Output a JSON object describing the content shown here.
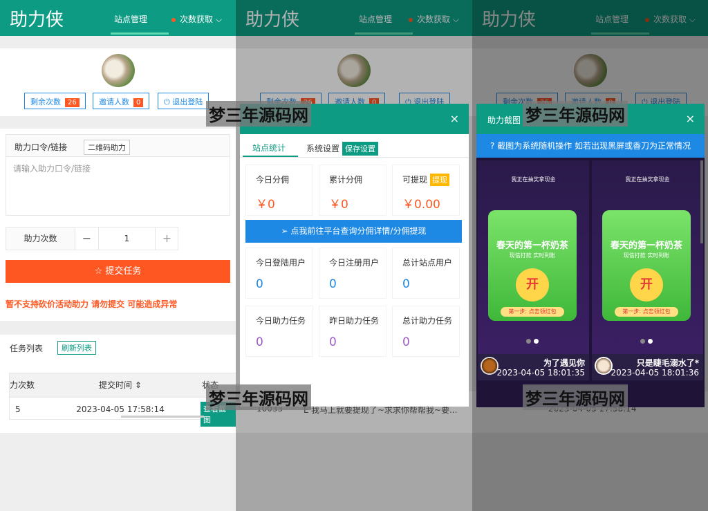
{
  "app": {
    "brand": "助力侠",
    "nav_site": "站点管理",
    "nav_count": "次数获取"
  },
  "user": {
    "remaining_label": "剩余次数",
    "remaining_value": "26",
    "invites_label": "邀请人数",
    "invites_value": "0",
    "logout_label": "退出登陆"
  },
  "form": {
    "code_label": "助力口令/链接",
    "qr_button": "二维码助力",
    "code_placeholder": "请输入助力口令/链接",
    "count_label": "助力次数",
    "count_value": "1",
    "minus": "−",
    "plus": "+",
    "submit_label": "提交任务",
    "warning": "暂不支持砍价活动助力 请勿提交 可能造成异常"
  },
  "tasks": {
    "title": "任务列表",
    "refresh": "刷新列表",
    "columns": [
      "力次数",
      "提交时间",
      "状态"
    ],
    "rows": [
      {
        "count": "5",
        "time": "2023-04-05 17:58:14",
        "action": "查看截图"
      }
    ]
  },
  "stats_modal": {
    "tab_stats": "站点统计",
    "tab_settings": "系统设置",
    "save_button": "保存设置",
    "close": "×",
    "today_commission_label": "今日分佣",
    "today_commission_value": "￥0",
    "total_commission_label": "累计分佣",
    "total_commission_value": "￥0",
    "withdrawable_label": "可提现",
    "withdraw_button": "提现",
    "withdrawable_value": "￥0.00",
    "platform_link": "点我前往平台查询分佣详情/分佣提现",
    "today_login_label": "今日登陆用户",
    "today_login_value": "0",
    "today_register_label": "今日注册用户",
    "today_register_value": "0",
    "total_users_label": "总计站点用户",
    "total_users_value": "0",
    "today_tasks_label": "今日助力任务",
    "today_tasks_value": "0",
    "yesterday_tasks_label": "昨日助力任务",
    "yesterday_tasks_value": "0",
    "total_tasks_label": "总计助力任务",
    "total_tasks_value": "0",
    "bg_row_id": "10033",
    "bg_row_text": "E'我马上就要提现了~求求你帮帮我~要..."
  },
  "screenshot_modal": {
    "title": "助力截图",
    "close": "×",
    "notice": "截图为系统随机操作 如若出现黑屏或香刀为正常情况",
    "shots": [
      {
        "title": "我正在抽奖拿现金",
        "headline": "春天的第一杯奶茶",
        "sub": "现信打款 实时到账",
        "coin": "开",
        "step": "第一步: 点击领红包",
        "name": "为了遇见你",
        "time": "2023-04-05 18:01:35"
      },
      {
        "title": "我正在抽奖拿现金",
        "headline": "春天的第一杯奶茶",
        "sub": "现信打款 实时到账",
        "coin": "开",
        "step": "第一步: 点击领红包",
        "name": "只是睫毛溺水了*",
        "time": "2023-04-05 18:01:36"
      }
    ],
    "bg_time": "2023-04-05 17:58:14"
  },
  "watermark": "梦三年源码网",
  "colors": {
    "primary": "#0e9b83",
    "accent": "#ff5722",
    "blue": "#1e88e5",
    "purple": "#9c5bc9",
    "gold": "#ffb800"
  }
}
